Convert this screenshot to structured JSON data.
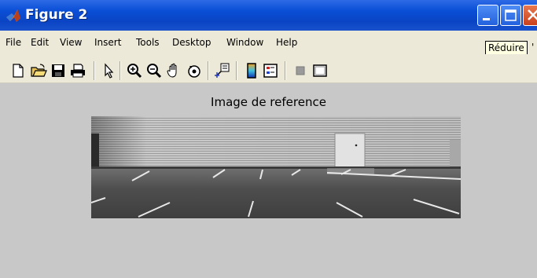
{
  "window": {
    "title": "Figure 2",
    "controls": [
      "minimize-icon",
      "maximize-icon",
      "close-icon"
    ]
  },
  "menu": {
    "items": [
      "File",
      "Edit",
      "View",
      "Insert",
      "Tools",
      "Desktop",
      "Window",
      "Help"
    ]
  },
  "tooltip": {
    "text": "Réduire",
    "extra": "'"
  },
  "toolbar": {
    "icons": [
      "new-figure-icon",
      "open-file-icon",
      "save-icon",
      "print-icon",
      "edit-plot-arrow-icon",
      "zoom-in-icon",
      "zoom-out-icon",
      "pan-hand-icon",
      "rotate-3d-icon",
      "data-cursor-icon",
      "colorbar-icon",
      "legend-icon",
      "hide-plot-tools-icon",
      "show-plot-tools-icon"
    ]
  },
  "figure": {
    "title": "Image de reference",
    "image_description": "grayscale photo"
  },
  "colors": {
    "titlebar": "#0a4fd6",
    "background": "#c8c8c8",
    "menubar": "#ece9d8",
    "close_button": "#d6502a"
  }
}
